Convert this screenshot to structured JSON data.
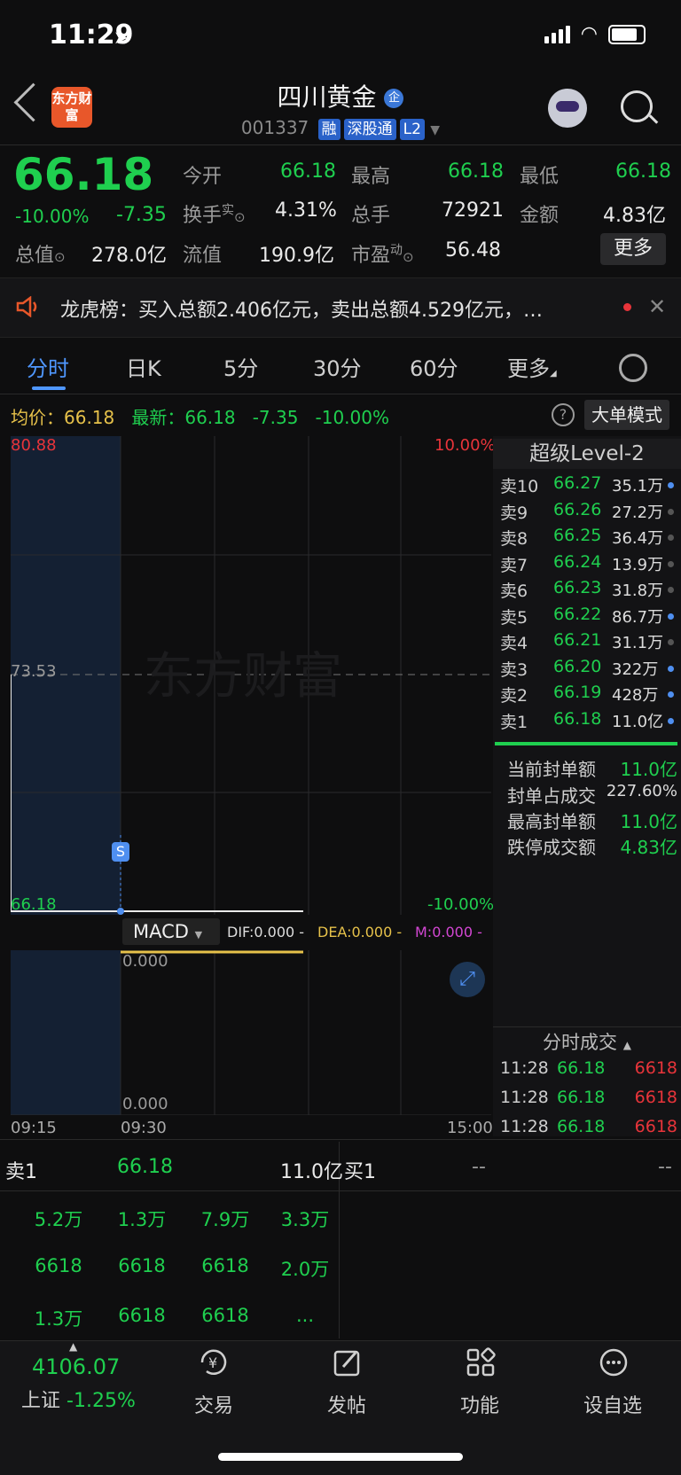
{
  "status": {
    "time": "11:29"
  },
  "header": {
    "logo": "东方财富",
    "title": "四川黄金",
    "title_badge": "企",
    "code": "001337",
    "tags": [
      "融",
      "深股通",
      "L2"
    ]
  },
  "quote": {
    "price": "66.18",
    "pct": "-10.00%",
    "change": "-7.35",
    "open_label": "今开",
    "open": "66.18",
    "high_label": "最高",
    "high": "66.18",
    "low_label": "最低",
    "low": "66.18",
    "turnover_label": "换手",
    "turnover_sup": "实",
    "turnover": "4.31%",
    "volume_label": "总手",
    "volume": "72921",
    "amount_label": "金额",
    "amount": "4.83亿",
    "mktcap_label": "总值",
    "mktcap": "278.0亿",
    "float_label": "流值",
    "float": "190.9亿",
    "pe_label": "市盈",
    "pe_sup": "动",
    "pe": "56.48",
    "more_label": "更多"
  },
  "notice": {
    "text": "龙虎榜：买入总额2.406亿元，卖出总额4.529亿元，…"
  },
  "tabs": [
    "分时",
    "日K",
    "5分",
    "30分",
    "60分",
    "更多"
  ],
  "infoline": {
    "avg_label": "均价：",
    "avg": "66.18",
    "last_label": "最新：",
    "last": "66.18",
    "chg": "-7.35",
    "pct": "-10.00%",
    "big_mode": "大单模式"
  },
  "chart": {
    "y_top": "80.88",
    "y_mid": "73.53",
    "y_bot": "66.18",
    "pct_top": "10.00%",
    "pct_bot": "-10.00%",
    "watermark": "东方财富",
    "marker": "S",
    "macd_label": "MACD",
    "dif": "DIF:0.000 -",
    "dea": "DEA:0.000 -",
    "m": "M:0.000 -",
    "macd_top": "0.000",
    "macd_bot": "0.000",
    "times": [
      "09:15",
      "09:30",
      "15:00"
    ]
  },
  "level2": {
    "title": "超级Level-2",
    "asks": [
      {
        "label": "卖10",
        "price": "66.27",
        "vol": "35.1万",
        "dot": "blue"
      },
      {
        "label": "卖9",
        "price": "66.26",
        "vol": "27.2万",
        "dot": "gray"
      },
      {
        "label": "卖8",
        "price": "66.25",
        "vol": "36.4万",
        "dot": "gray"
      },
      {
        "label": "卖7",
        "price": "66.24",
        "vol": "13.9万",
        "dot": "gray"
      },
      {
        "label": "卖6",
        "price": "66.23",
        "vol": "31.8万",
        "dot": "gray"
      },
      {
        "label": "卖5",
        "price": "66.22",
        "vol": "86.7万",
        "dot": "blue"
      },
      {
        "label": "卖4",
        "price": "66.21",
        "vol": "31.1万",
        "dot": "gray"
      },
      {
        "label": "卖3",
        "price": "66.20",
        "vol": "322万",
        "dot": "blue"
      },
      {
        "label": "卖2",
        "price": "66.19",
        "vol": "428万",
        "dot": "blue"
      },
      {
        "label": "卖1",
        "price": "66.18",
        "vol": "11.0亿",
        "dot": "blue"
      }
    ],
    "seal": [
      {
        "k": "当前封单额",
        "v": "11.0亿"
      },
      {
        "k": "封单占成交",
        "v": "227.60%"
      },
      {
        "k": "最高封单额",
        "v": "11.0亿"
      },
      {
        "k": "跌停成交额",
        "v": "4.83亿"
      }
    ],
    "trades_title": "分时成交",
    "trades": [
      {
        "t": "11:28",
        "p": "66.18",
        "v": "6618"
      },
      {
        "t": "11:28",
        "p": "66.18",
        "v": "6618"
      },
      {
        "t": "11:28",
        "p": "66.18",
        "v": "6618"
      }
    ]
  },
  "orderbook": {
    "sell_label": "卖1",
    "sell_price": "66.18",
    "sell_vol": "11.0亿",
    "buy_label": "买1",
    "buy_price": "--",
    "buy_vol": "--",
    "rows": [
      [
        "5.2万",
        "1.3万",
        "7.9万",
        "3.3万"
      ],
      [
        "6618",
        "6618",
        "6618",
        "2.0万"
      ],
      [
        "1.3万",
        "6618",
        "6618",
        "..."
      ]
    ]
  },
  "nav": {
    "index_value": "4106.07",
    "index_name": "上证",
    "index_pct": "-1.25%",
    "items": [
      "交易",
      "发帖",
      "功能",
      "设自选"
    ]
  }
}
